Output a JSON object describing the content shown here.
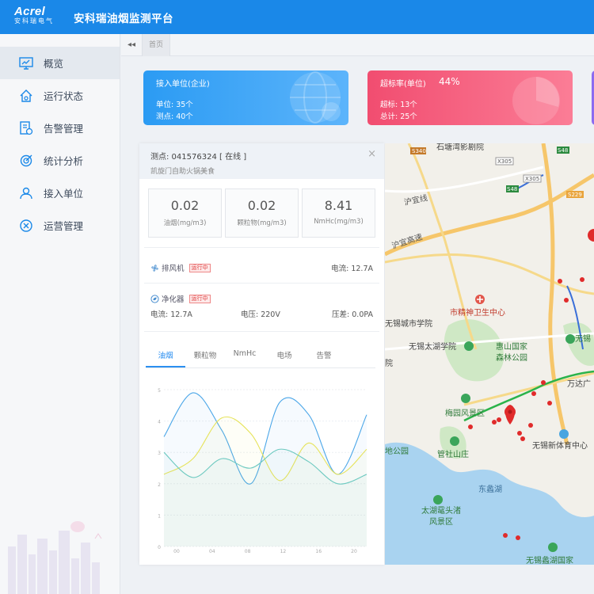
{
  "header": {
    "logo_brand": "Acrel",
    "logo_sub": "安科瑞电气",
    "app_title": "安科瑞油烟监测平台"
  },
  "sidebar": {
    "items": [
      {
        "label": "概览",
        "icon": "monitor-icon"
      },
      {
        "label": "运行状态",
        "icon": "house-icon"
      },
      {
        "label": "告警管理",
        "icon": "alarm-doc-icon"
      },
      {
        "label": "统计分析",
        "icon": "target-icon"
      },
      {
        "label": "接入单位",
        "icon": "users-icon"
      },
      {
        "label": "运营管理",
        "icon": "tools-icon"
      }
    ]
  },
  "tabs": {
    "collapse": "◂◂",
    "active": "首页"
  },
  "cards": [
    {
      "title": "接入单位(企业)",
      "line1": "单位: 35个",
      "line2": "测点: 40个",
      "color": "#2b9bf3"
    },
    {
      "title": "超标率(单位)",
      "value": "44%",
      "line1": "超标: 13个",
      "line2": "总计: 25个",
      "color": "#f14d70"
    }
  ],
  "panel": {
    "point": "测点: 041576324 [ 在线 ]",
    "name": "凯旋门自助火锅美食",
    "close": "×",
    "metrics": [
      {
        "value": "0.02",
        "unit": "油烟(mg/m3)"
      },
      {
        "value": "0.02",
        "unit": "颗粒物(mg/m3)"
      },
      {
        "value": "8.41",
        "unit": "NmHc(mg/m3)"
      }
    ],
    "fan": {
      "label": "排风机",
      "status": "运行中",
      "current": "电流: 12.7A"
    },
    "purifier": {
      "label": "净化器",
      "status": "运行中",
      "current": "电流: 12.7A",
      "voltage": "电压: 220V",
      "pressure": "压差: 0.0PA"
    },
    "chart_tabs": [
      "油烟",
      "颗粒物",
      "NmHc",
      "电场",
      "告警"
    ]
  },
  "chart_data": {
    "type": "line",
    "x": [
      "00",
      "04",
      "08",
      "12",
      "16",
      "20"
    ],
    "ylim": [
      0,
      5
    ],
    "yticks": [
      "0",
      "1",
      "2",
      "3",
      "4",
      "5"
    ],
    "series": [
      {
        "color": "#4aa6e8",
        "values": [
          3.5,
          4.9,
          3.7,
          2.0,
          4.6,
          4.2,
          2.3,
          4.2
        ]
      },
      {
        "color": "#e6e35a",
        "values": [
          2.3,
          2.8,
          4.1,
          3.6,
          2.1,
          3.3,
          2.3,
          3.1
        ]
      },
      {
        "color": "#6cc9c0",
        "values": [
          3.0,
          2.2,
          2.8,
          2.5,
          3.1,
          2.7,
          2.0,
          2.3
        ]
      }
    ]
  },
  "map": {
    "labels": [
      "石塘湾影剧院",
      "沪宜线",
      "沪宜高速",
      "市精神卫生中心",
      "无锡城市学院",
      "无锡太湖学院",
      "惠山国家",
      "森林公园",
      "梅园风景区",
      "管社山庄",
      "东蠡湖",
      "太湖鼋头渚",
      "风景区",
      "无锡新体育中心",
      "万达广",
      "无锡蠡湖国家",
      "地公园",
      "院",
      "无锡"
    ],
    "road_signs": [
      "S340",
      "X305",
      "X305",
      "S48",
      "S48",
      "S229"
    ]
  }
}
